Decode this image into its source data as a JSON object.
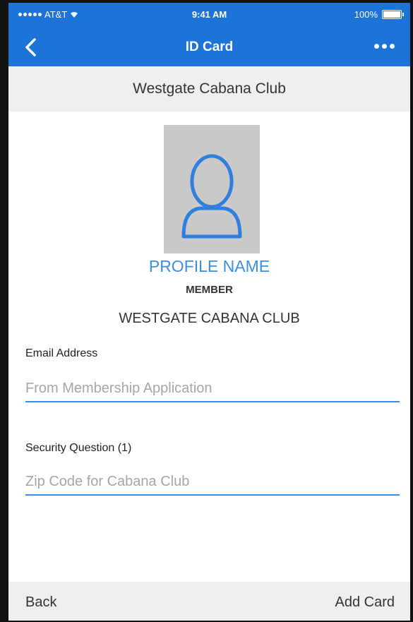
{
  "status_bar": {
    "carrier": "AT&T",
    "time": "9:41 AM",
    "battery": "100%"
  },
  "nav": {
    "title": "ID Card",
    "back_icon": "chevron-left-icon",
    "more_icon": "more-dots-icon"
  },
  "subheader": {
    "title": "Westgate Cabana Club"
  },
  "profile": {
    "name": "PROFILE NAME",
    "role": "MEMBER",
    "club": "WESTGATE CABANA CLUB",
    "avatar_icon": "user-icon"
  },
  "form": {
    "email": {
      "label": "Email Address",
      "placeholder": "From Membership Application",
      "value": ""
    },
    "security": {
      "label": "Security Question (1)",
      "placeholder": "Zip Code for Cabana Club",
      "value": ""
    }
  },
  "toolbar": {
    "back_label": "Back",
    "add_label": "Add Card"
  },
  "colors": {
    "primary": "#1e73d8",
    "accent": "#3a8ee6",
    "surface": "#efefef"
  }
}
